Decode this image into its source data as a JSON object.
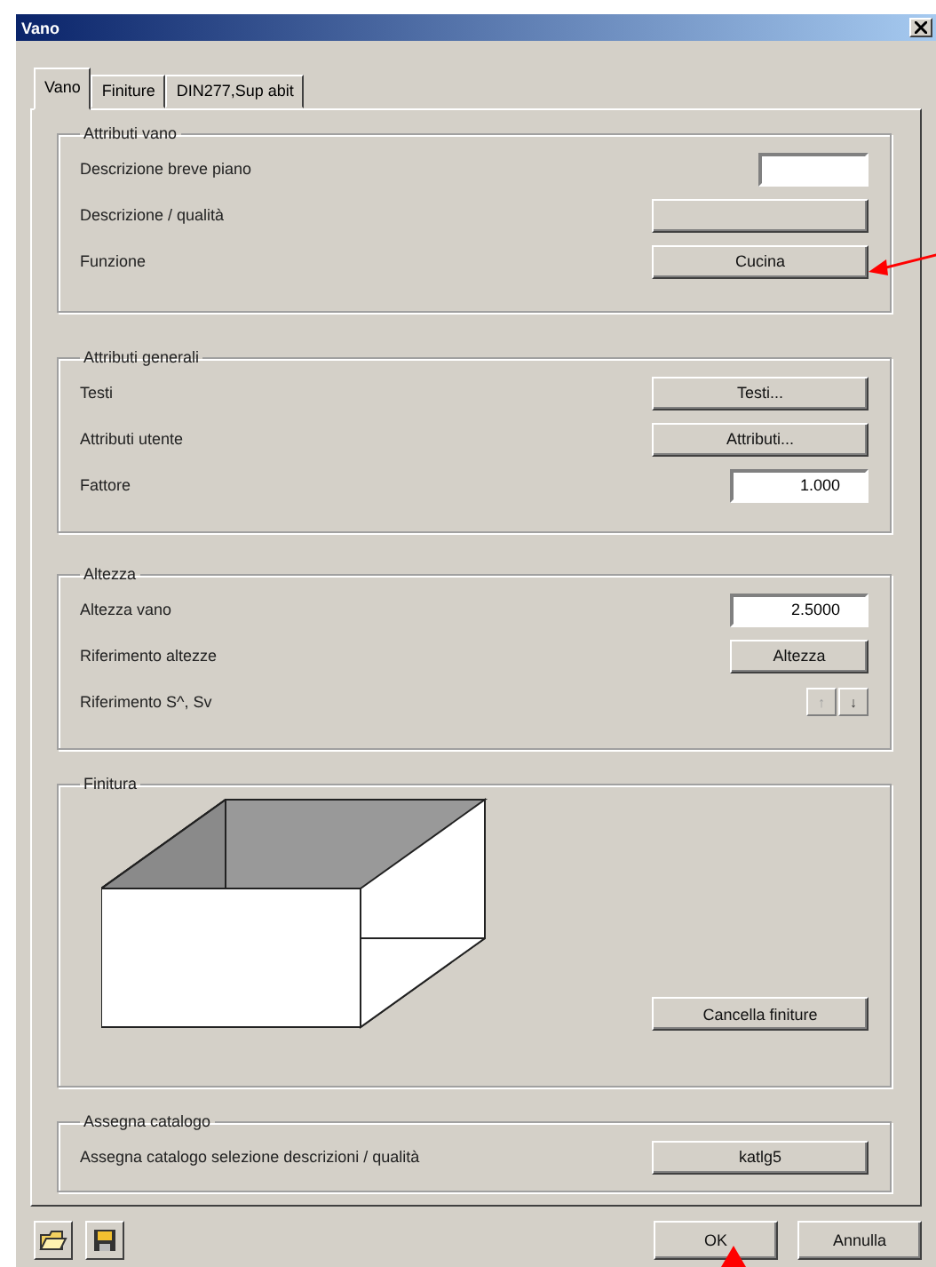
{
  "window": {
    "title": "Vano"
  },
  "tabs": [
    {
      "label": "Vano",
      "selected": true
    },
    {
      "label": "Finiture",
      "selected": false
    },
    {
      "label": "DIN277,Sup abit",
      "selected": false
    }
  ],
  "groups": [
    {
      "title": "Attributi vano",
      "rows": [
        {
          "kind": "field",
          "label": "Descrizione breve piano"
        },
        {
          "kind": "button",
          "label": "Descrizione / qualità"
        },
        {
          "kind": "button",
          "label": "Funzione",
          "button": "Cucina"
        }
      ]
    },
    {
      "title": "Attributi generali",
      "rows": [
        {
          "kind": "button",
          "label": "Testi",
          "button": "Testi..."
        },
        {
          "kind": "button",
          "label": "Attributi utente",
          "button": "Attributi..."
        },
        {
          "kind": "field",
          "label": "Fattore",
          "value": "1.000"
        }
      ]
    },
    {
      "title": "Altezza",
      "rows": [
        {
          "kind": "field",
          "label": "Altezza vano",
          "value": "2.5000"
        },
        {
          "kind": "small-button",
          "label": "Riferimento altezze",
          "button": "Altezza"
        },
        {
          "kind": "arrows",
          "label": "Riferimento S^, Sv",
          "buttons": [
            {
              "label": "↑",
              "disabled": true
            },
            {
              "label": "↓",
              "disabled": false
            }
          ]
        }
      ]
    },
    {
      "title": "Finitura",
      "kind": "drawing",
      "button": "Cancella finiture"
    },
    {
      "title": "Assegna catalogo",
      "rows": [
        {
          "kind": "button",
          "label": "Assegna catalogo selezione descrizioni / qualità",
          "button": "katlg5"
        }
      ]
    }
  ],
  "footer": {
    "buttons": [
      "OK",
      "Annulla"
    ]
  }
}
